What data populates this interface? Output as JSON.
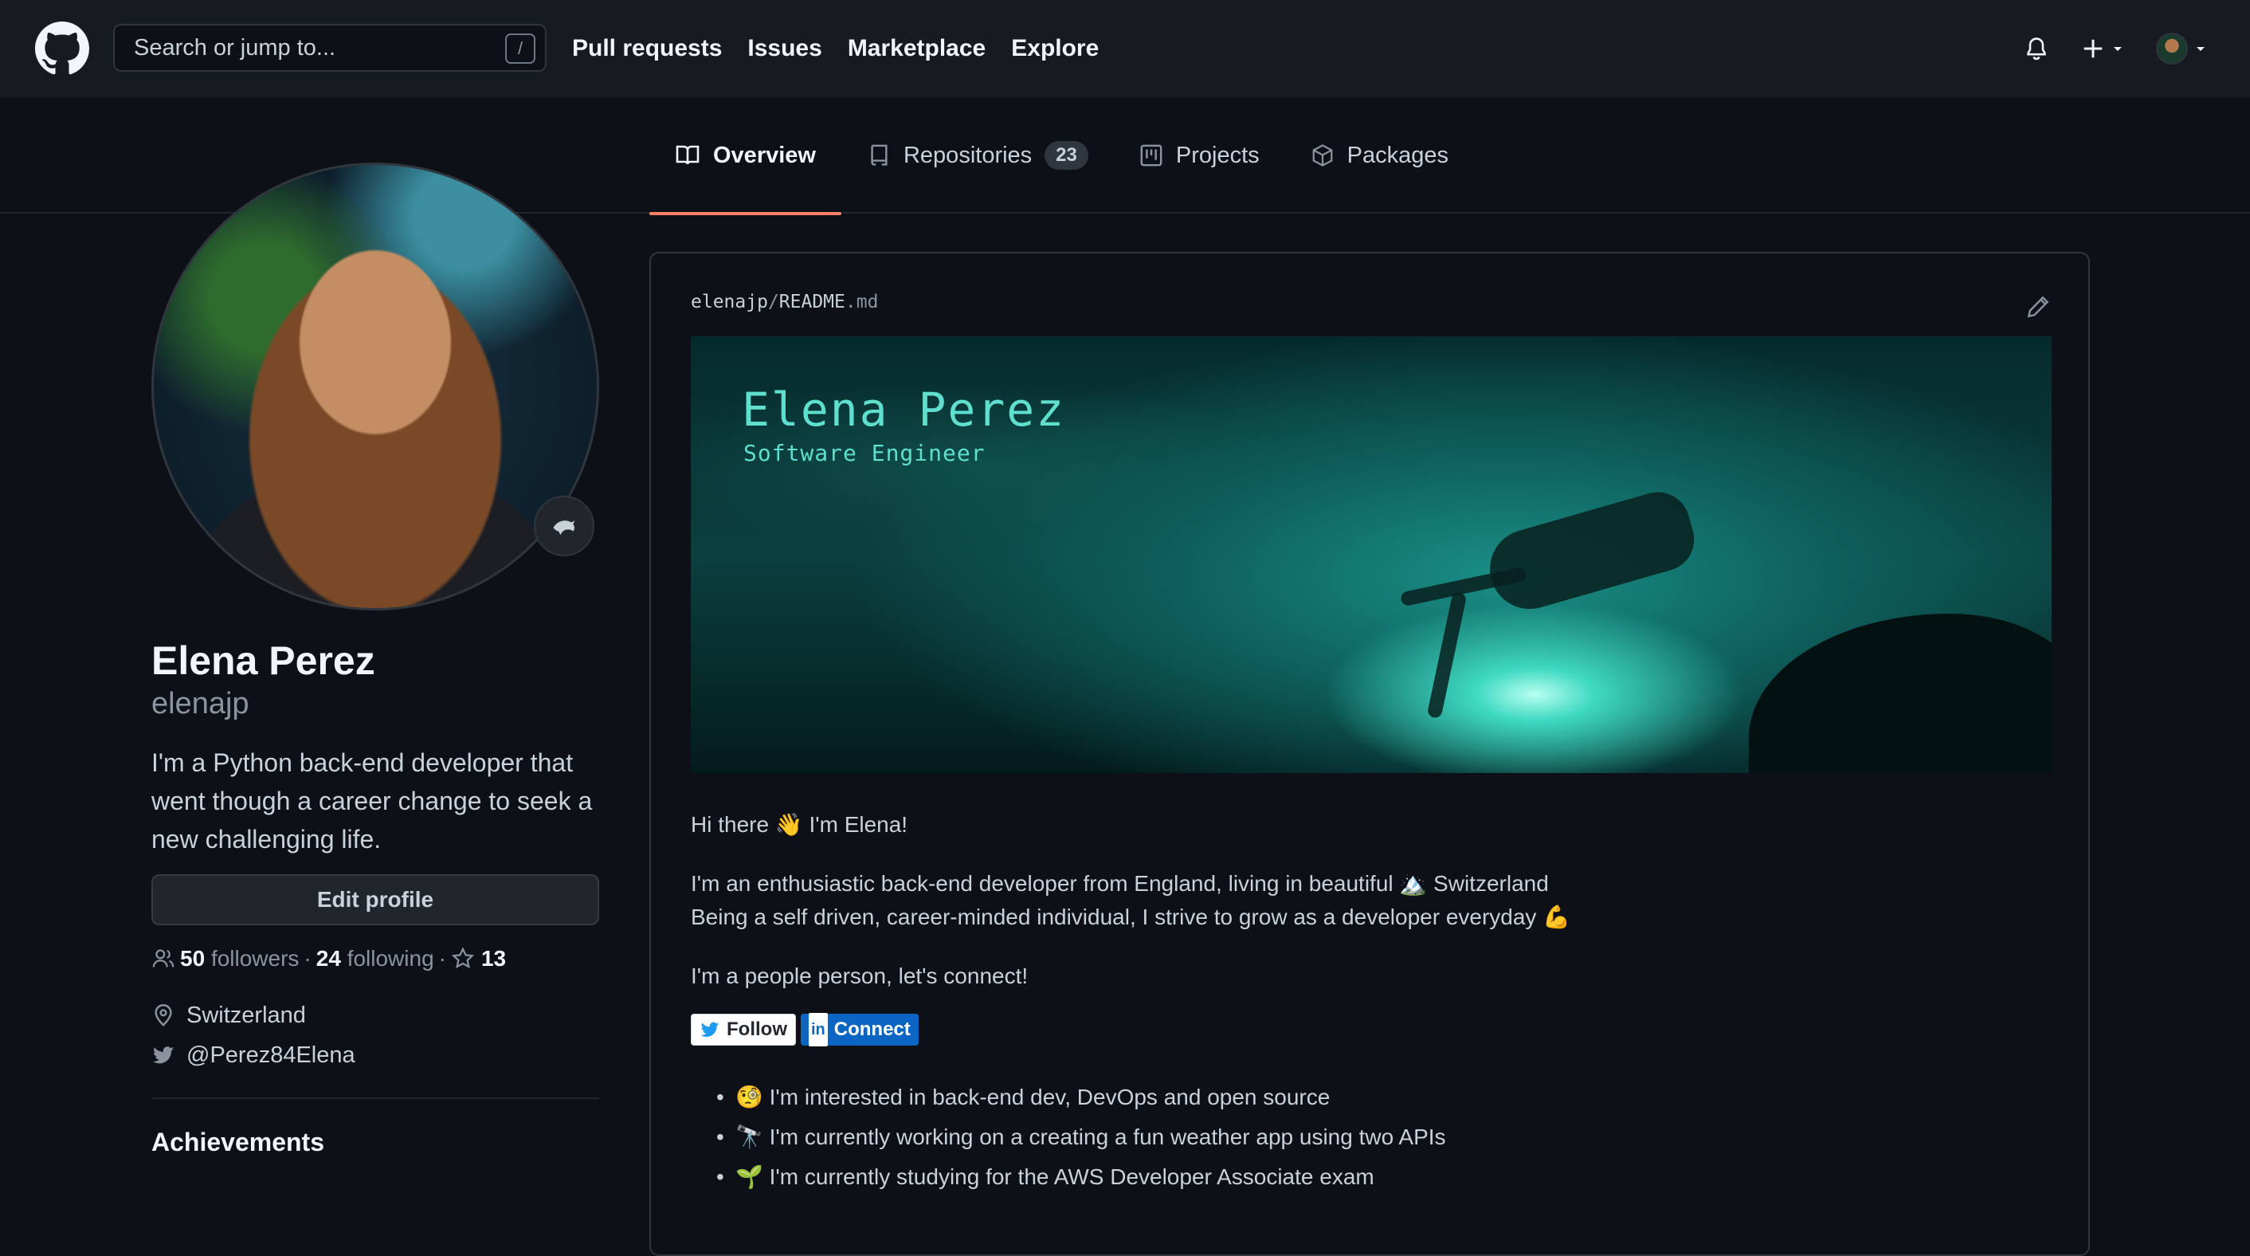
{
  "header": {
    "search_placeholder": "Search or jump to...",
    "search_shortcut": "/",
    "nav": [
      "Pull requests",
      "Issues",
      "Marketplace",
      "Explore"
    ]
  },
  "tabs": [
    {
      "label": "Overview",
      "active": true
    },
    {
      "label": "Repositories",
      "count": "23"
    },
    {
      "label": "Projects"
    },
    {
      "label": "Packages"
    }
  ],
  "profile": {
    "name": "Elena Perez",
    "username": "elenajp",
    "bio": "I'm a Python back-end developer that went though a career change to seek a new challenging life.",
    "edit_label": "Edit profile",
    "followers_count": "50",
    "followers_label": "followers",
    "following_count": "24",
    "following_label": "following",
    "stars": "13",
    "location": "Switzerland",
    "twitter": "@Perez84Elena",
    "achievements_heading": "Achievements"
  },
  "readme": {
    "owner": "elenajp",
    "separator": "/",
    "filename": "README",
    "ext": ".md",
    "banner_title": "Elena Perez",
    "banner_subtitle": "Software Engineer",
    "greeting": "Hi there 👋 I'm Elena!",
    "para1_line1": "I'm an enthusiastic back-end developer from England, living in beautiful 🏔️ Switzerland",
    "para1_line2": "Being a self driven, career-minded individual, I strive to grow as a developer everyday 💪",
    "para2": "I'm a people person, let's connect!",
    "badge_twitter": "Follow",
    "badge_linkedin": "Connect",
    "badge_linkedin_mark": "in",
    "list": [
      "🧐 I'm interested in back-end dev, DevOps and open source",
      "🔭 I'm currently working on a creating a fun weather app using two APIs",
      "🌱 I'm currently studying for the AWS Developer Associate exam"
    ]
  },
  "colors": {
    "background": "#0d1117",
    "header": "#161b22",
    "tab_underline": "#f78166",
    "linkedin": "#0a66c2"
  },
  "icons": [
    "github-logo-icon",
    "bell-icon",
    "plus-icon",
    "book-icon",
    "repo-icon",
    "project-icon",
    "package-icon",
    "people-icon",
    "star-icon",
    "location-icon",
    "twitter-icon",
    "pencil-icon",
    "dolphin-icon"
  ]
}
